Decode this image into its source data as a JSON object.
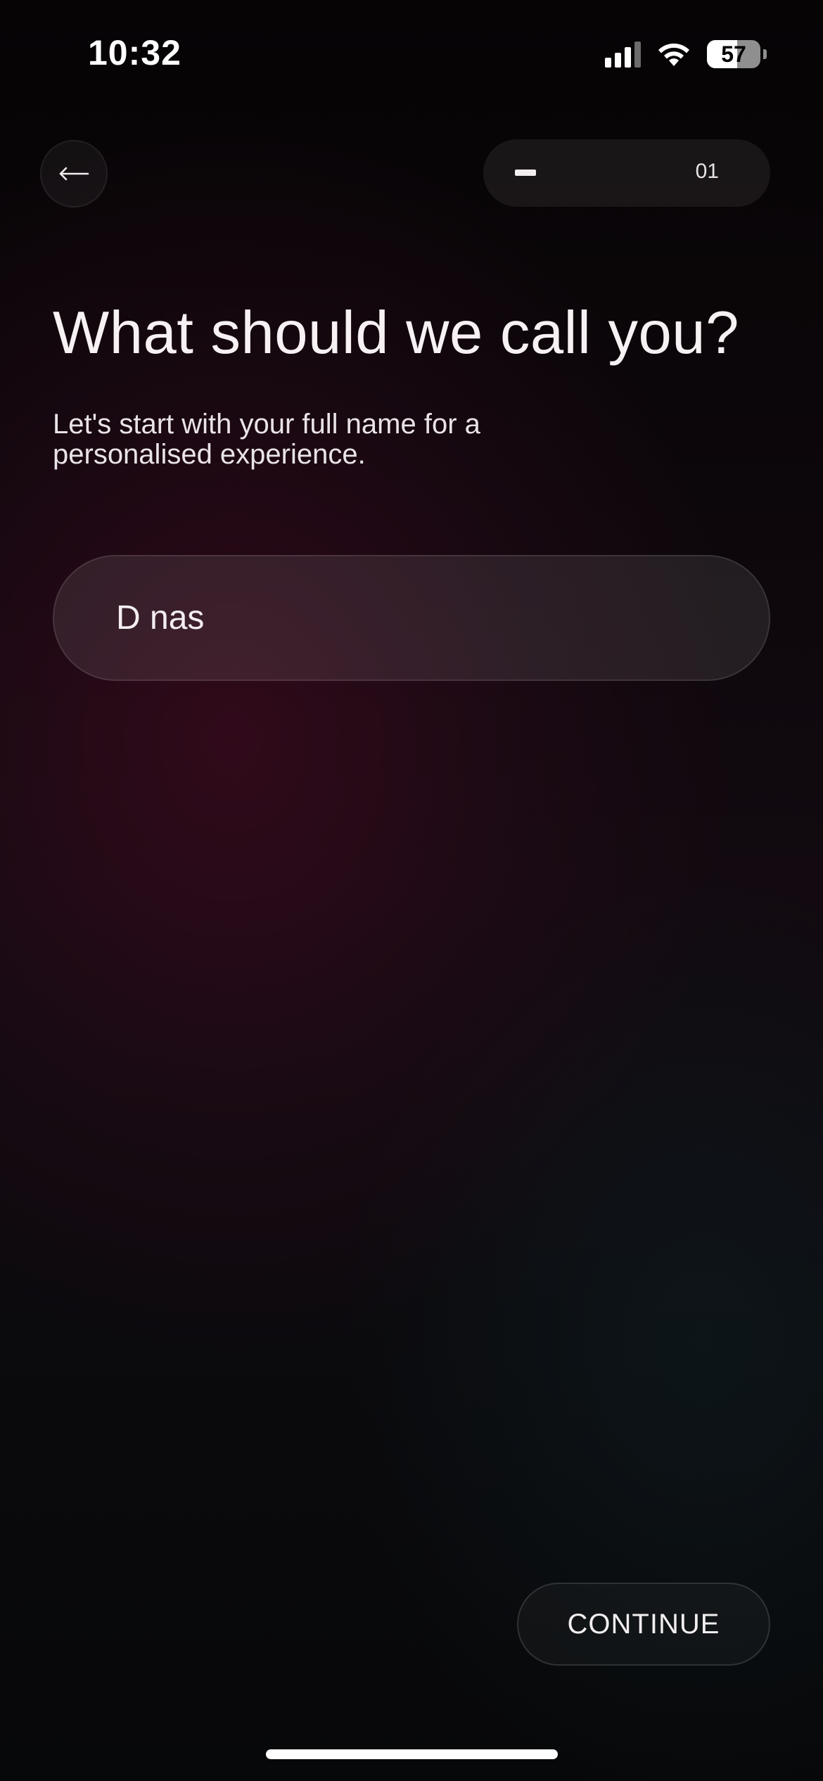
{
  "status_bar": {
    "time": "10:32",
    "battery": "57",
    "icons": [
      "cellular-signal-icon",
      "wifi-icon",
      "battery-icon"
    ]
  },
  "nav": {
    "back_icon": "arrow-left-icon",
    "step_number": "01"
  },
  "header": {
    "title": "What should we call you?",
    "subtitle": "Let's start with your full name for a personalised experience."
  },
  "name_field": {
    "value": "D nas"
  },
  "footer": {
    "continue_label": "CONTINUE"
  },
  "colors": {
    "background": "#050405",
    "text": "#f4eef1",
    "accent_gradient": "#3c0a1e"
  }
}
